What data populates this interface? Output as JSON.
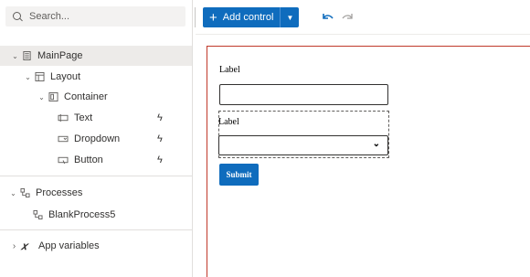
{
  "search": {
    "placeholder": "Search..."
  },
  "toolbar": {
    "add_control_label": "Add control"
  },
  "tree": {
    "main_page": "MainPage",
    "layout": "Layout",
    "container": "Container",
    "text": "Text",
    "dropdown": "Dropdown",
    "button": "Button",
    "processes": "Processes",
    "blank_process": "BlankProcess5",
    "app_variables": "App variables"
  },
  "canvas": {
    "label1": "Label",
    "label2": "Label",
    "submit_label": "Submit"
  },
  "colors": {
    "accent": "#0f6cbd",
    "canvas_border": "#c0392b",
    "selected_row": "#edebe9"
  }
}
